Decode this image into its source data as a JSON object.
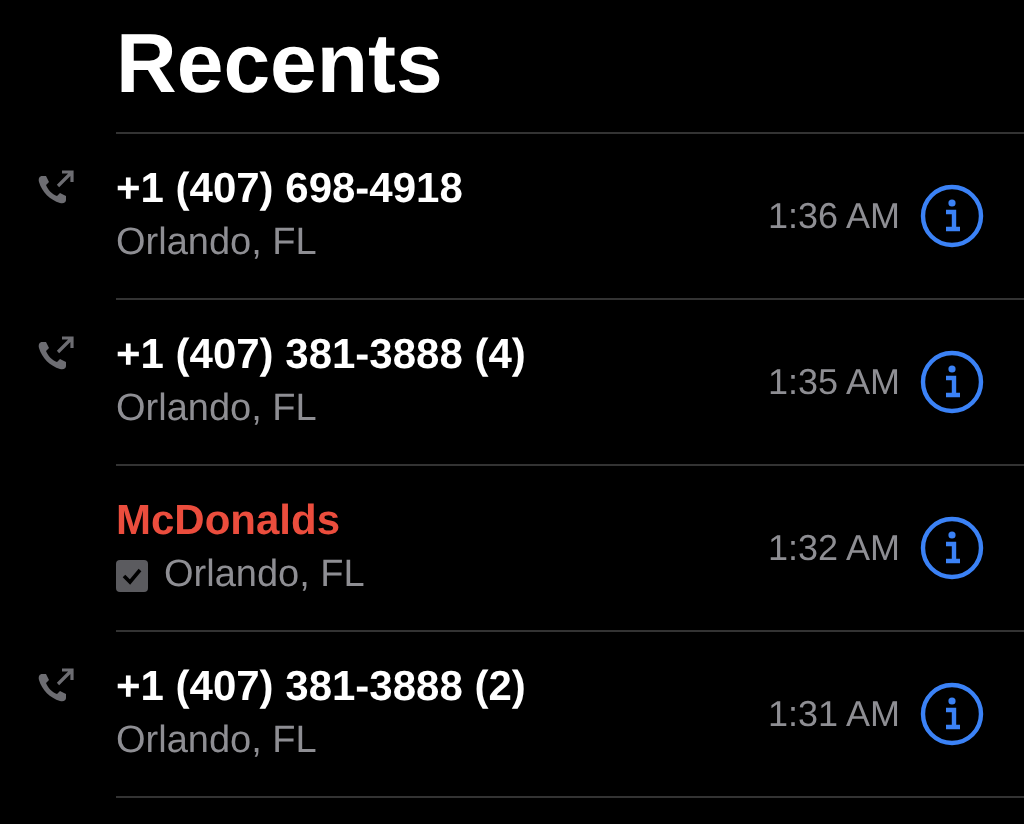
{
  "title": "Recents",
  "calls": [
    {
      "kind": "outgoing",
      "name": "+1 (407) 698-4918",
      "location": "Orlando, FL",
      "business": false,
      "time": "1:36 AM"
    },
    {
      "kind": "outgoing",
      "name": "+1 (407) 381-3888 (4)",
      "location": "Orlando, FL",
      "business": false,
      "time": "1:35 AM"
    },
    {
      "kind": "missed",
      "name": "McDonalds",
      "location": "Orlando, FL",
      "business": true,
      "time": "1:32 AM"
    },
    {
      "kind": "outgoing",
      "name": "+1 (407) 381-3888 (2)",
      "location": "Orlando, FL",
      "business": false,
      "time": "1:31 AM"
    }
  ]
}
